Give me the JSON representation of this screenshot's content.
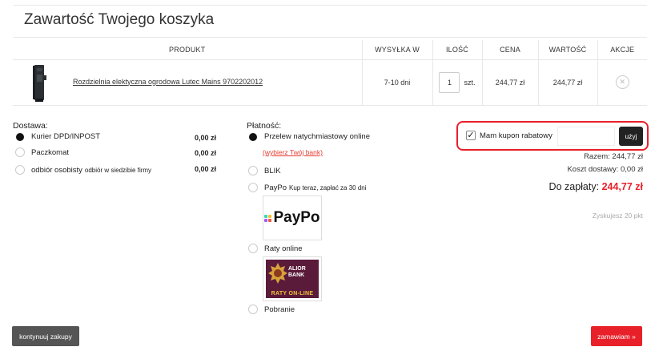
{
  "page": {
    "title": "Zawartość Twojego koszyka"
  },
  "table": {
    "headers": {
      "product": "PRODUKT",
      "shipping": "WYSYŁKA W",
      "quantity": "ILOŚĆ",
      "price": "CENA",
      "value": "WARTOŚĆ",
      "actions": "AKCJE"
    },
    "rows": [
      {
        "product_name": "Rozdzielnia elektyczna ogrodowa Lutec Mains 9702202012",
        "shipping": "7-10 dni",
        "quantity": "1",
        "unit": "szt.",
        "price": "244,77 zł",
        "value": "244,77 zł",
        "delete_icon": "close-icon"
      }
    ]
  },
  "delivery": {
    "label": "Dostawa:",
    "options": [
      {
        "label": "Kurier DPD/INPOST",
        "note": "",
        "price": "0,00 zł",
        "selected": true
      },
      {
        "label": "Paczkomat",
        "note": "",
        "price": "0,00 zł",
        "selected": false
      },
      {
        "label": "odbiór osobisty",
        "note": "odbiór w siedzibie firmy",
        "price": "0,00 zł",
        "selected": false
      }
    ]
  },
  "payment": {
    "label": "Płatność:",
    "options": [
      {
        "label": "Przelew natychmiastowy online",
        "note": "",
        "selected": true
      },
      {
        "label": "BLIK",
        "note": "",
        "selected": false
      },
      {
        "label": "PayPo",
        "note": "Kup teraz, zapłać za 30 dni",
        "selected": false
      },
      {
        "label": "Raty online",
        "note": "",
        "selected": false
      },
      {
        "label": "Pobranie",
        "note": "",
        "selected": false
      }
    ],
    "choose_bank": "(wybierz Twój bank)",
    "paypo_logo": "PayPo",
    "alior_logo": {
      "line1": "ALIOR",
      "line2": "BANK",
      "banner": "RATY ON-LINE"
    }
  },
  "coupon": {
    "checkbox_label": "Mam kupon rabatowy",
    "checked": true,
    "input_value": "",
    "button": "użyj"
  },
  "summary": {
    "subtotal": "Razem: 244,77 zł",
    "shipping_cost": "Koszt dostawy: 0,00 zł",
    "total_label": "Do zapłaty:",
    "total_value": "244,77 zł",
    "points": "Zyskujesz 20 pkt"
  },
  "buttons": {
    "continue": "kontynuuj zakupy",
    "order": "zamawiam »"
  },
  "colors": {
    "accent_red": "#e8202a",
    "dark_button": "#222222",
    "continue_button": "#555555",
    "link_red": "#e63a2e"
  }
}
